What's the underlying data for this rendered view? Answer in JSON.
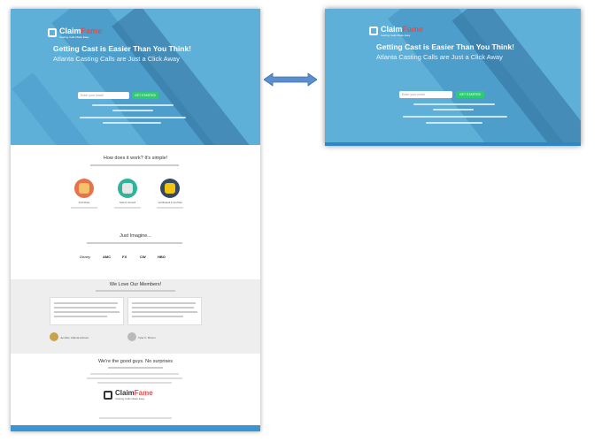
{
  "brand": {
    "name_main": "Claim",
    "name_accent": "Fame",
    "tagline": "Casting Calls Made Easy"
  },
  "hero": {
    "headline": "Getting Cast is Easier Than You Think!",
    "subheadline": "Atlanta Casting Calls are Just a Click Away",
    "email_placeholder": "Enter your email",
    "cta_label": "GET STARTED"
  },
  "how": {
    "title": "How does it work? It's simple!",
    "steps": [
      "Find Roles",
      "Submit Yourself",
      "Get Booked & Get Paid"
    ]
  },
  "imagine": {
    "title": "Just Imagine...",
    "brands": [
      "Disney",
      "AMC",
      "FX",
      "CW",
      "HBO"
    ]
  },
  "members": {
    "title": "We Love Our Members!",
    "people": [
      "Jennifer, Atlanta Actress",
      "Tyler K. Brown"
    ]
  },
  "good": {
    "title": "We're the good guys. No surprises"
  },
  "colors": {
    "hero_blue": "#5fb0d9",
    "cta_green": "#2ecc71",
    "accent_red": "#e84a4a",
    "arrow_blue": "#5b8fd0"
  },
  "icons": {
    "arrow": "double-headed-arrow-icon"
  }
}
